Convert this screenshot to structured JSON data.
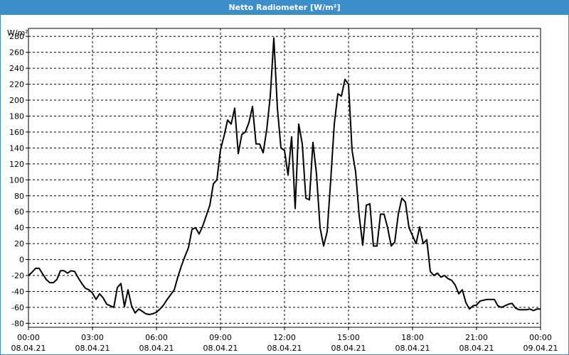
{
  "window": {
    "title": "Netto Radiometer [W/m²]"
  },
  "colors": {
    "titlebar": "#3c8fc8",
    "line": "#000000",
    "grid": "#000000",
    "frame": "#000000"
  },
  "chart_data": {
    "type": "line",
    "title": "Netto Radiometer [W/m²]",
    "ylabel": "W/m²",
    "ylim": [
      -85,
      290
    ],
    "xlim_hours": [
      0,
      24
    ],
    "grid": true,
    "legend": "none",
    "y_ticks": [
      -80,
      -60,
      -40,
      -20,
      0,
      20,
      40,
      60,
      80,
      100,
      120,
      140,
      160,
      180,
      200,
      220,
      240,
      260,
      280
    ],
    "x_ticks": [
      {
        "time": "00:00",
        "date": "08.04.21"
      },
      {
        "time": "03:00",
        "date": "08.04.21"
      },
      {
        "time": "06:00",
        "date": "08.04.21"
      },
      {
        "time": "09:00",
        "date": "08.04.21"
      },
      {
        "time": "12:00",
        "date": "08.04.21"
      },
      {
        "time": "15:00",
        "date": "08.04.21"
      },
      {
        "time": "18:00",
        "date": "08.04.21"
      },
      {
        "time": "21:00",
        "date": "08.04.21"
      },
      {
        "time": "00:00",
        "date": "09.04.21"
      }
    ],
    "series": [
      {
        "x": [
          "08.04.21 00:00",
          "08.04.21 00:10",
          "08.04.21 00:20",
          "08.04.21 00:30",
          "08.04.21 00:40",
          "08.04.21 00:50",
          "08.04.21 01:00",
          "08.04.21 01:10",
          "08.04.21 01:20",
          "08.04.21 01:30",
          "08.04.21 01:40",
          "08.04.21 01:50",
          "08.04.21 02:00",
          "08.04.21 02:10",
          "08.04.21 02:20",
          "08.04.21 02:30",
          "08.04.21 02:40",
          "08.04.21 02:50",
          "08.04.21 03:00",
          "08.04.21 03:10",
          "08.04.21 03:20",
          "08.04.21 03:30",
          "08.04.21 03:40",
          "08.04.21 03:50",
          "08.04.21 04:00",
          "08.04.21 04:10",
          "08.04.21 04:20",
          "08.04.21 04:30",
          "08.04.21 04:40",
          "08.04.21 04:50",
          "08.04.21 05:00",
          "08.04.21 05:10",
          "08.04.21 05:20",
          "08.04.21 05:30",
          "08.04.21 05:40",
          "08.04.21 05:50",
          "08.04.21 06:00",
          "08.04.21 06:10",
          "08.04.21 06:20",
          "08.04.21 06:30",
          "08.04.21 06:40",
          "08.04.21 06:50",
          "08.04.21 07:00",
          "08.04.21 07:10",
          "08.04.21 07:20",
          "08.04.21 07:30",
          "08.04.21 07:40",
          "08.04.21 07:50",
          "08.04.21 08:00",
          "08.04.21 08:10",
          "08.04.21 08:20",
          "08.04.21 08:30",
          "08.04.21 08:40",
          "08.04.21 08:50",
          "08.04.21 09:00",
          "08.04.21 09:10",
          "08.04.21 09:20",
          "08.04.21 09:30",
          "08.04.21 09:40",
          "08.04.21 09:50",
          "08.04.21 10:00",
          "08.04.21 10:10",
          "08.04.21 10:20",
          "08.04.21 10:30",
          "08.04.21 10:40",
          "08.04.21 10:50",
          "08.04.21 11:00",
          "08.04.21 11:10",
          "08.04.21 11:20",
          "08.04.21 11:30",
          "08.04.21 11:40",
          "08.04.21 11:50",
          "08.04.21 12:00",
          "08.04.21 12:10",
          "08.04.21 12:20",
          "08.04.21 12:30",
          "08.04.21 12:40",
          "08.04.21 12:50",
          "08.04.21 13:00",
          "08.04.21 13:10",
          "08.04.21 13:20",
          "08.04.21 13:30",
          "08.04.21 13:40",
          "08.04.21 13:50",
          "08.04.21 14:00",
          "08.04.21 14:10",
          "08.04.21 14:20",
          "08.04.21 14:30",
          "08.04.21 14:40",
          "08.04.21 14:50",
          "08.04.21 15:00",
          "08.04.21 15:10",
          "08.04.21 15:20",
          "08.04.21 15:30",
          "08.04.21 15:40",
          "08.04.21 15:50",
          "08.04.21 16:00",
          "08.04.21 16:10",
          "08.04.21 16:20",
          "08.04.21 16:30",
          "08.04.21 16:40",
          "08.04.21 16:50",
          "08.04.21 17:00",
          "08.04.21 17:10",
          "08.04.21 17:20",
          "08.04.21 17:30",
          "08.04.21 17:40",
          "08.04.21 17:50",
          "08.04.21 18:00",
          "08.04.21 18:10",
          "08.04.21 18:20",
          "08.04.21 18:30",
          "08.04.21 18:40",
          "08.04.21 18:50",
          "08.04.21 19:00",
          "08.04.21 19:10",
          "08.04.21 19:20",
          "08.04.21 19:30",
          "08.04.21 19:40",
          "08.04.21 19:50",
          "08.04.21 20:00",
          "08.04.21 20:10",
          "08.04.21 20:20",
          "08.04.21 20:30",
          "08.04.21 20:40",
          "08.04.21 20:50",
          "08.04.21 21:00",
          "08.04.21 21:10",
          "08.04.21 21:20",
          "08.04.21 21:30",
          "08.04.21 21:40",
          "08.04.21 21:50",
          "08.04.21 22:00",
          "08.04.21 22:10",
          "08.04.21 22:20",
          "08.04.21 22:30",
          "08.04.21 22:40",
          "08.04.21 22:50",
          "08.04.21 23:00",
          "08.04.21 23:10",
          "08.04.21 23:20",
          "08.04.21 23:30",
          "08.04.21 23:40",
          "08.04.21 23:50",
          "09.04.21 00:00"
        ],
        "values": [
          -20,
          -16,
          -11,
          -11,
          -18,
          -25,
          -29,
          -29,
          -25,
          -14,
          -14,
          -17,
          -14,
          -15,
          -23,
          -30,
          -36,
          -38,
          -42,
          -50,
          -43,
          -48,
          -56,
          -58,
          -60,
          -35,
          -30,
          -59,
          -38,
          -58,
          -67,
          -62,
          -65,
          -68,
          -69,
          -68,
          -66,
          -62,
          -57,
          -50,
          -44,
          -38,
          -22,
          -8,
          4,
          15,
          38,
          40,
          32,
          42,
          55,
          68,
          95,
          100,
          138,
          155,
          175,
          170,
          190,
          133,
          157,
          160,
          172,
          192,
          145,
          145,
          134,
          163,
          205,
          278,
          190,
          140,
          137,
          106,
          154,
          64,
          170,
          145,
          77,
          75,
          147,
          107,
          40,
          17,
          35,
          100,
          170,
          208,
          205,
          226,
          220,
          137,
          110,
          55,
          18,
          68,
          70,
          17,
          17,
          57,
          57,
          40,
          17,
          22,
          57,
          77,
          72,
          40,
          30,
          20,
          41,
          20,
          25,
          -15,
          -20,
          -17,
          -22,
          -20,
          -24,
          -26,
          -32,
          -43,
          -38,
          -54,
          -62,
          -58,
          -57,
          -52,
          -51,
          -50,
          -50,
          -50,
          -58,
          -60,
          -58,
          -56,
          -55,
          -61,
          -63,
          -63,
          -63,
          -62,
          -64,
          -62,
          -62
        ]
      }
    ]
  }
}
